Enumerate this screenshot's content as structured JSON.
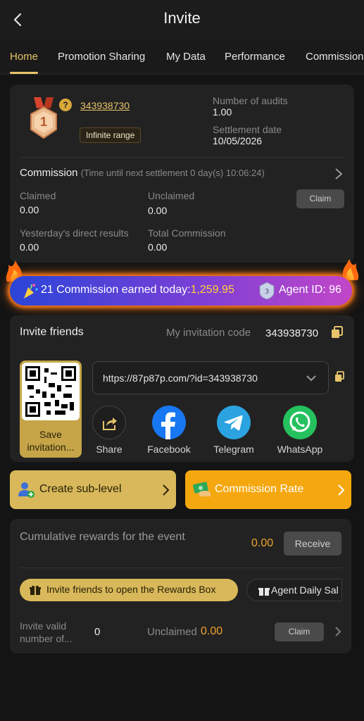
{
  "header": {
    "title": "Invite"
  },
  "tabs": [
    {
      "label": "Home"
    },
    {
      "label": "Promotion Sharing"
    },
    {
      "label": "My Data"
    },
    {
      "label": "Performance"
    },
    {
      "label": "Commission"
    }
  ],
  "profile": {
    "user_id": "343938730",
    "range_badge": "Infinite range",
    "audits_label": "Number of audits",
    "audits_value": "1.00",
    "settlement_label": "Settlement date",
    "settlement_value": "10/05/2026",
    "medal_level": "1",
    "help_glyph": "?"
  },
  "commission": {
    "title": "Commission",
    "note": "(Time until next settlement 0 day(s) 10:06:24)",
    "claimed_label": "Claimed",
    "claimed_value": "0.00",
    "unclaimed_label": "Unclaimed",
    "unclaimed_value": "0.00",
    "claim_button": "Claim",
    "yesterday_label": "Yesterday's direct results",
    "yesterday_value": "0.00",
    "total_label": "Total Commission",
    "total_value": "0.00"
  },
  "banner": {
    "text_prefix": "21 Commission earned today:",
    "amount": "1,259.95",
    "agent_text": "Agent ID: 96"
  },
  "invite": {
    "title": "Invite friends",
    "code_label": "My invitation code",
    "code_value": "343938730",
    "url": "https://87p87p.com/?id=343938730",
    "qr_label": "Save invitation...",
    "share_buttons": [
      {
        "label": "Share",
        "icon": "share-icon"
      },
      {
        "label": "Facebook",
        "icon": "facebook-icon"
      },
      {
        "label": "Telegram",
        "icon": "telegram-icon"
      },
      {
        "label": "WhatsApp",
        "icon": "whatsapp-icon"
      }
    ]
  },
  "actions": {
    "create_sublevel": "Create sub-level",
    "commission_rate": "Commission Rate"
  },
  "rewards": {
    "title": "Cumulative rewards for the event",
    "amount": "0.00",
    "receive_button": "Receive",
    "pill_invite": "Invite friends to open the Rewards Box",
    "pill_agent": "Agent Daily Sal",
    "valid_label": "Invite valid number of...",
    "valid_value": "0",
    "unclaimed_label": "Unclaimed",
    "unclaimed_value": "0.00",
    "claim_button": "Claim"
  },
  "colors": {
    "accent_gold": "#e7c46a",
    "amount_orange": "#f0a32a",
    "commission_rate_bg": "#f5a70f",
    "create_sublevel_bg": "#d8b85a"
  }
}
